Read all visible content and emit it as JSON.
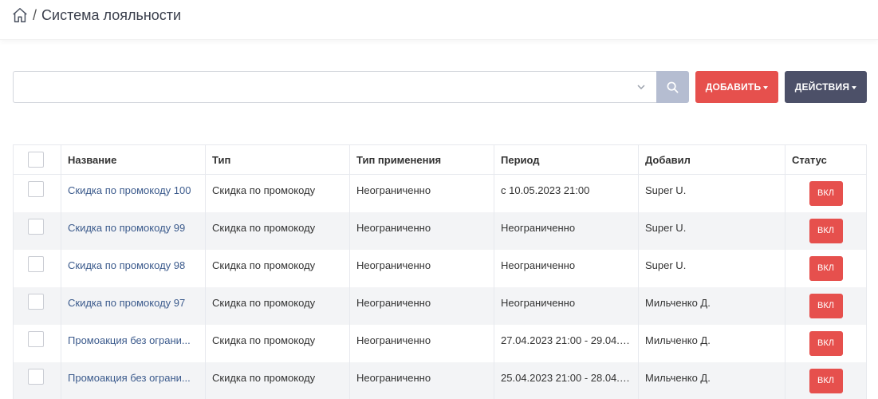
{
  "breadcrumb": {
    "title": "Система лояльности",
    "separator": "/"
  },
  "toolbar": {
    "add_label": "ДОБАВИТЬ",
    "actions_label": "ДЕЙСТВИЯ"
  },
  "table": {
    "headers": [
      "Название",
      "Тип",
      "Тип применения",
      "Период",
      "Добавил",
      "Статус"
    ],
    "rows": [
      {
        "name": "Скидка по промокоду 100",
        "type": "Скидка по промокоду",
        "apply": "Неограниченно",
        "period": "с 10.05.2023 21:00",
        "author": "Super U.",
        "status": "ВКЛ"
      },
      {
        "name": "Скидка по промокоду 99",
        "type": "Скидка по промокоду",
        "apply": "Неограниченно",
        "period": "Неограниченно",
        "author": "Super U.",
        "status": "ВКЛ"
      },
      {
        "name": "Скидка по промокоду 98",
        "type": "Скидка по промокоду",
        "apply": "Неограниченно",
        "period": "Неограниченно",
        "author": "Super U.",
        "status": "ВКЛ"
      },
      {
        "name": "Скидка по промокоду 97",
        "type": "Скидка по промокоду",
        "apply": "Неограниченно",
        "period": "Неограниченно",
        "author": "Мильченко Д.",
        "status": "ВКЛ"
      },
      {
        "name": "Промоакция без ограни...",
        "type": "Скидка по промокоду",
        "apply": "Неограниченно",
        "period": "27.04.2023 21:00 - 29.04.2...",
        "author": "Мильченко Д.",
        "status": "ВКЛ"
      },
      {
        "name": "Промоакция без ограни...",
        "type": "Скидка по промокоду",
        "apply": "Неограниченно",
        "period": "25.04.2023 21:00 - 28.04.2...",
        "author": "Мильченко Д.",
        "status": "ВКЛ"
      }
    ]
  },
  "colors": {
    "primary_red": "#e6504d",
    "dark_button": "#4c5068",
    "search_button": "#b5bdd1",
    "link": "#3b5a8c"
  },
  "icons": {
    "home": "home-icon",
    "search": "search-icon",
    "dropdown": "chevron-down-icon"
  }
}
